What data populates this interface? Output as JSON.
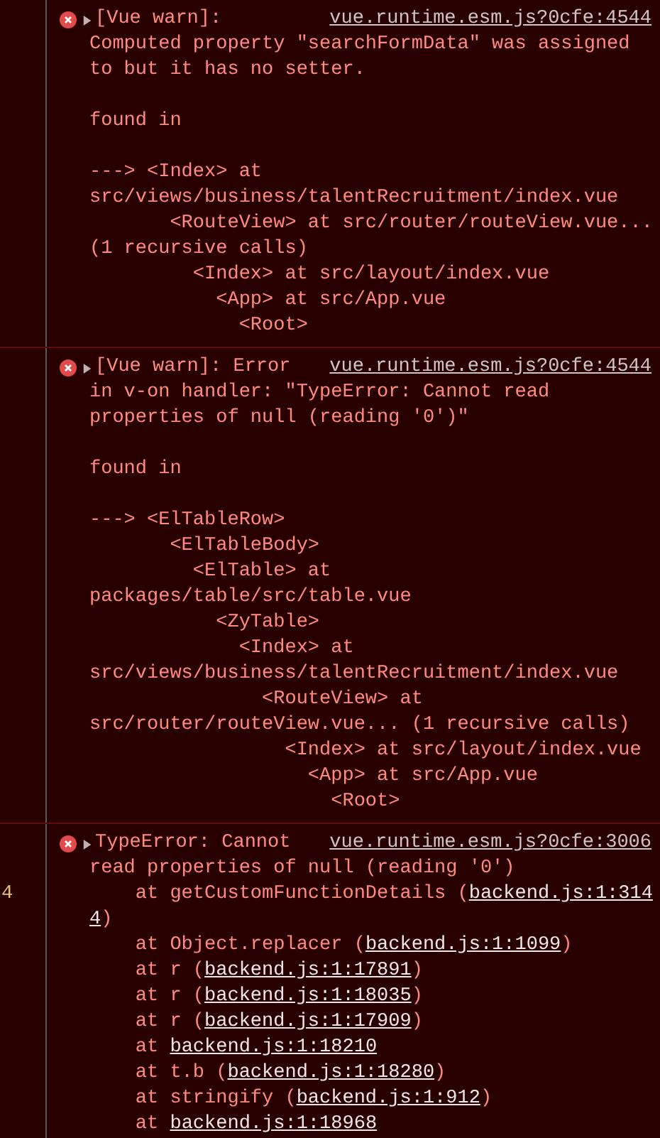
{
  "messages": [
    {
      "kind": "error",
      "expanded": false,
      "header": "[Vue warn]:",
      "source": "vue.runtime.esm.js?0cfe:4544",
      "lines": [
        {
          "kind": "text",
          "parts": [
            {
              "kind": "text",
              "text": "Computed property \"searchFormData\" was assigned"
            }
          ]
        },
        {
          "kind": "text",
          "parts": [
            {
              "kind": "text",
              "text": "to but it has no setter."
            }
          ]
        },
        {
          "kind": "gap"
        },
        {
          "kind": "text",
          "parts": [
            {
              "kind": "text",
              "text": "found in"
            }
          ]
        },
        {
          "kind": "gap"
        },
        {
          "kind": "text",
          "parts": [
            {
              "kind": "text",
              "text": "---> <Index> at"
            }
          ]
        },
        {
          "kind": "text",
          "parts": [
            {
              "kind": "text",
              "text": "src/views/business/talentRecruitment/index.vue"
            }
          ]
        },
        {
          "kind": "text",
          "parts": [
            {
              "kind": "text",
              "text": "       <RouteView> at src/router/routeView.vue..."
            }
          ]
        },
        {
          "kind": "text",
          "parts": [
            {
              "kind": "text",
              "text": "(1 recursive calls)"
            }
          ]
        },
        {
          "kind": "text",
          "parts": [
            {
              "kind": "text",
              "text": "         <Index> at src/layout/index.vue"
            }
          ]
        },
        {
          "kind": "text",
          "parts": [
            {
              "kind": "text",
              "text": "           <App> at src/App.vue"
            }
          ]
        },
        {
          "kind": "text",
          "parts": [
            {
              "kind": "text",
              "text": "             <Root>"
            }
          ]
        }
      ]
    },
    {
      "kind": "error",
      "expanded": false,
      "header": "[Vue warn]: Error",
      "source": "vue.runtime.esm.js?0cfe:4544",
      "lines": [
        {
          "kind": "text",
          "parts": [
            {
              "kind": "text",
              "text": "in v-on handler: \"TypeError: Cannot read"
            }
          ]
        },
        {
          "kind": "text",
          "parts": [
            {
              "kind": "text",
              "text": "properties of null (reading '0')\""
            }
          ]
        },
        {
          "kind": "gap"
        },
        {
          "kind": "text",
          "parts": [
            {
              "kind": "text",
              "text": "found in"
            }
          ]
        },
        {
          "kind": "gap"
        },
        {
          "kind": "text",
          "parts": [
            {
              "kind": "text",
              "text": "---> <ElTableRow>"
            }
          ]
        },
        {
          "kind": "text",
          "parts": [
            {
              "kind": "text",
              "text": "       <ElTableBody>"
            }
          ]
        },
        {
          "kind": "text",
          "parts": [
            {
              "kind": "text",
              "text": "         <ElTable> at"
            }
          ]
        },
        {
          "kind": "text",
          "parts": [
            {
              "kind": "text",
              "text": "packages/table/src/table.vue"
            }
          ]
        },
        {
          "kind": "text",
          "parts": [
            {
              "kind": "text",
              "text": "           <ZyTable>"
            }
          ]
        },
        {
          "kind": "text",
          "parts": [
            {
              "kind": "text",
              "text": "             <Index> at"
            }
          ]
        },
        {
          "kind": "text",
          "parts": [
            {
              "kind": "text",
              "text": "src/views/business/talentRecruitment/index.vue"
            }
          ]
        },
        {
          "kind": "text",
          "parts": [
            {
              "kind": "text",
              "text": "               <RouteView> at"
            }
          ]
        },
        {
          "kind": "text",
          "parts": [
            {
              "kind": "text",
              "text": "src/router/routeView.vue... (1 recursive calls)"
            }
          ]
        },
        {
          "kind": "text",
          "parts": [
            {
              "kind": "text",
              "text": "                 <Index> at src/layout/index.vue"
            }
          ]
        },
        {
          "kind": "text",
          "parts": [
            {
              "kind": "text",
              "text": "                   <App> at src/App.vue"
            }
          ]
        },
        {
          "kind": "text",
          "parts": [
            {
              "kind": "text",
              "text": "                     <Root>"
            }
          ]
        }
      ]
    },
    {
      "kind": "error",
      "expanded": false,
      "gutter_text": "4",
      "header": "TypeError: Cannot",
      "source": "vue.runtime.esm.js?0cfe:3006",
      "lines": [
        {
          "kind": "text",
          "parts": [
            {
              "kind": "text",
              "text": "read properties of null (reading '0')"
            }
          ]
        },
        {
          "kind": "text",
          "parts": [
            {
              "kind": "text",
              "text": "    at getCustomFunctionDetails ("
            },
            {
              "kind": "link",
              "text": "backend.js:1:314"
            }
          ]
        },
        {
          "kind": "text",
          "parts": [
            {
              "kind": "link",
              "text": "4"
            },
            {
              "kind": "text",
              "text": ")"
            }
          ]
        },
        {
          "kind": "text",
          "parts": [
            {
              "kind": "text",
              "text": "    at Object.replacer ("
            },
            {
              "kind": "link",
              "text": "backend.js:1:1099"
            },
            {
              "kind": "text",
              "text": ")"
            }
          ]
        },
        {
          "kind": "text",
          "parts": [
            {
              "kind": "text",
              "text": "    at r ("
            },
            {
              "kind": "link",
              "text": "backend.js:1:17891"
            },
            {
              "kind": "text",
              "text": ")"
            }
          ]
        },
        {
          "kind": "text",
          "parts": [
            {
              "kind": "text",
              "text": "    at r ("
            },
            {
              "kind": "link",
              "text": "backend.js:1:18035"
            },
            {
              "kind": "text",
              "text": ")"
            }
          ]
        },
        {
          "kind": "text",
          "parts": [
            {
              "kind": "text",
              "text": "    at r ("
            },
            {
              "kind": "link",
              "text": "backend.js:1:17909"
            },
            {
              "kind": "text",
              "text": ")"
            }
          ]
        },
        {
          "kind": "text",
          "parts": [
            {
              "kind": "text",
              "text": "    at "
            },
            {
              "kind": "link",
              "text": "backend.js:1:18210"
            }
          ]
        },
        {
          "kind": "text",
          "parts": [
            {
              "kind": "text",
              "text": "    at t.b ("
            },
            {
              "kind": "link",
              "text": "backend.js:1:18280"
            },
            {
              "kind": "text",
              "text": ")"
            }
          ]
        },
        {
          "kind": "text",
          "parts": [
            {
              "kind": "text",
              "text": "    at stringify ("
            },
            {
              "kind": "link",
              "text": "backend.js:1:912"
            },
            {
              "kind": "text",
              "text": ")"
            }
          ]
        },
        {
          "kind": "text",
          "parts": [
            {
              "kind": "text",
              "text": "    at "
            },
            {
              "kind": "link",
              "text": "backend.js:1:18968"
            }
          ]
        }
      ]
    }
  ]
}
